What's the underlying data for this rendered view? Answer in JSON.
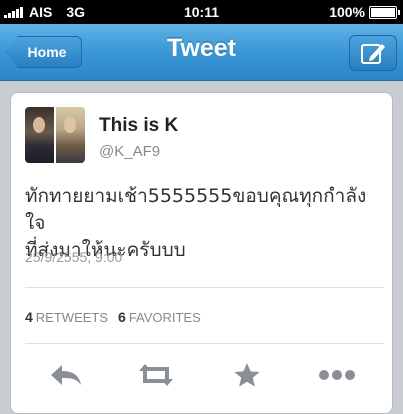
{
  "status_bar": {
    "carrier": "AIS",
    "network": "3G",
    "time": "10:11",
    "battery": "100%",
    "battery_level": 1.0
  },
  "nav": {
    "back_label": "Home",
    "title": "Tweet",
    "compose_icon": "compose-icon"
  },
  "tweet": {
    "display_name": "This is K",
    "username": "@K_AF9",
    "text_line1": "ทักทายยามเช้า5555555ขอบคุณทุกกำลังใจ",
    "text_line2": "ที่ส่งมาให้นะครับบบ",
    "timestamp": "25/9/2555, 9:00",
    "retweet_count": "4",
    "retweet_label": "RETWEETS",
    "favorite_count": "6",
    "favorite_label": "FAVORITES"
  },
  "actions": [
    "reply-icon",
    "retweet-icon",
    "favorite-icon",
    "more-icon"
  ],
  "colors": {
    "navbar": "#3a97d6",
    "icon_gray": "#8a8f96"
  }
}
